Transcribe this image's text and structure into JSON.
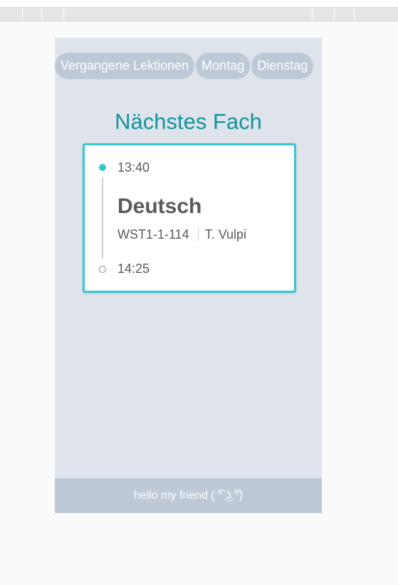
{
  "nav": {
    "tabs": [
      {
        "label": "Vergangene Lektionen"
      },
      {
        "label": "Montag"
      },
      {
        "label": "Dienstag"
      }
    ]
  },
  "main": {
    "title": "Nächstes Fach"
  },
  "lesson": {
    "start_time": "13:40",
    "end_time": "14:25",
    "subject": "Deutsch",
    "room": "WST1-1-114",
    "teacher": "T. Vulpi"
  },
  "footer": {
    "text": "hello my friend ( ͡° ͜ʖ ͡°)"
  },
  "colors": {
    "accent": "#37c8d4",
    "title": "#14939a",
    "app_background": "#dfe4ec",
    "tab_background": "#bdc9d7",
    "footer_background": "#bdc9d7",
    "text": "#5b5b5b"
  }
}
